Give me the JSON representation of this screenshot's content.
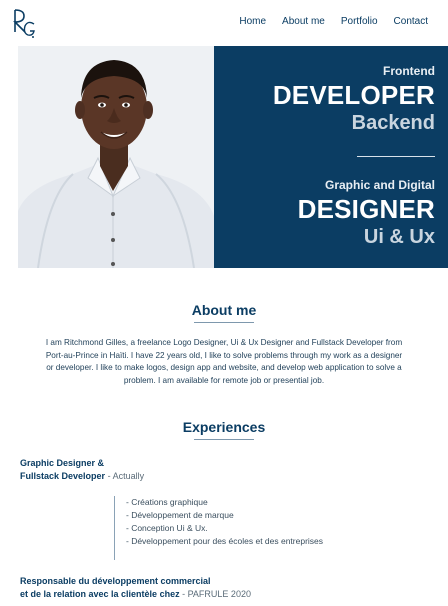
{
  "brand": {
    "logo_text": "RG"
  },
  "nav": {
    "items": [
      "Home",
      "About me",
      "Portfolio",
      "Contact"
    ]
  },
  "hero": {
    "photo_alt": "Portrait",
    "line1": "Frontend",
    "line2": "DEVELOPER",
    "line3": "Backend",
    "line4": "Graphic and Digital",
    "line5": "DESIGNER",
    "line6": "Ui & Ux"
  },
  "about": {
    "title": "About me",
    "text": "I am Ritchmond Gilles, a freelance Logo Designer, Ui & Ux Designer and Fullstack Developer from Port-au-Prince in Haïti. I have 22 years old, I like to solve problems through my work as a designer or developer. I like to make logos, design app and website, and develop web application to solve a problem. I am available for remote job or presential job."
  },
  "experiences": {
    "title": "Experiences",
    "job1": {
      "role_line1": "Graphic Designer &",
      "role_line2": "Fullstack Developer",
      "company": "-  Actually",
      "tasks": [
        "- Créations graphique",
        "- Développement de marque",
        "- Conception  Ui & Ux.",
        "- Développement pour des écoles et des entreprises"
      ]
    },
    "job2": {
      "role_line1": "Responsable du développement commercial",
      "role_line2": "et de la relation avec la clientèle chez",
      "company": "- PAFRULE 2020"
    }
  },
  "colors": {
    "primary": "#0b3d63",
    "text": "#1f3f58"
  }
}
